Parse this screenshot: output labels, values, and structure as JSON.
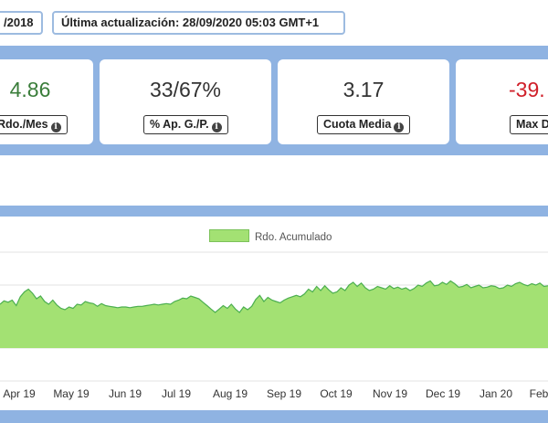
{
  "header": {
    "date_pill": "/2018",
    "update_label": "Última actualización: 28/09/2020 05:03 GMT+1"
  },
  "stats": [
    {
      "value": "4.86",
      "label": "Rdo./Mes",
      "color": "#3a7d3a"
    },
    {
      "value": "33/67%",
      "label": "% Ap. G./P.",
      "color": "#333333"
    },
    {
      "value": "3.17",
      "label": "Cuota Media",
      "color": "#333333"
    },
    {
      "value": "-39.",
      "label": "Max D",
      "color": "#d0202a"
    }
  ],
  "chart_data": {
    "type": "area",
    "series": [
      {
        "name": "Rdo. Acumulado",
        "color": "#a3e173",
        "line": "#4caf50"
      }
    ],
    "x_tick_labels": [
      "Apr 19",
      "May 19",
      "Jun 19",
      "Jul 19",
      "Aug 19",
      "Sep 19",
      "Oct 19",
      "Nov 19",
      "Dec 19",
      "Jan 20",
      "Feb"
    ],
    "values": [
      64,
      69,
      67,
      70,
      62,
      75,
      82,
      86,
      80,
      72,
      76,
      68,
      64,
      70,
      63,
      58,
      56,
      60,
      58,
      64,
      63,
      68,
      66,
      65,
      61,
      65,
      62,
      61,
      60,
      59,
      60,
      60,
      59,
      60,
      61,
      61,
      62,
      63,
      64,
      63,
      64,
      65,
      64,
      68,
      70,
      73,
      72,
      76,
      74,
      72,
      67,
      62,
      57,
      52,
      57,
      62,
      58,
      64,
      57,
      52,
      60,
      56,
      61,
      71,
      77,
      68,
      74,
      70,
      68,
      66,
      70,
      73,
      75,
      77,
      75,
      79,
      86,
      82,
      90,
      84,
      91,
      85,
      80,
      82,
      88,
      84,
      92,
      96,
      90,
      95,
      88,
      84,
      86,
      90,
      88,
      86,
      91,
      87,
      89,
      86,
      88,
      84,
      87,
      92,
      90,
      95,
      98,
      91,
      92,
      96,
      93,
      98,
      94,
      89,
      90,
      93,
      88,
      90,
      92,
      88,
      89,
      91,
      90,
      87,
      88,
      92,
      90,
      94,
      96,
      93,
      91,
      94,
      92,
      95,
      90,
      91
    ]
  }
}
